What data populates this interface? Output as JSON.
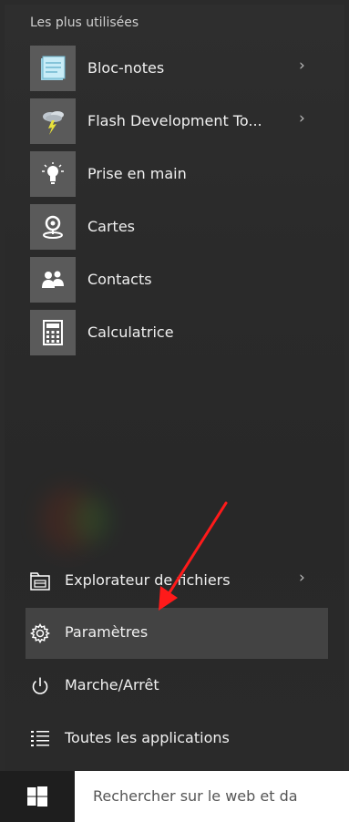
{
  "start_menu": {
    "section_header": "Les plus utilisées",
    "apps": [
      {
        "label": "Bloc-notes",
        "icon": "notepad-icon",
        "has_submenu": true
      },
      {
        "label": "Flash Development To...",
        "icon": "flash-development-icon",
        "has_submenu": true
      },
      {
        "label": "Prise en main",
        "icon": "lightbulb-icon",
        "has_submenu": false
      },
      {
        "label": "Cartes",
        "icon": "maps-icon",
        "has_submenu": false
      },
      {
        "label": "Contacts",
        "icon": "contacts-icon",
        "has_submenu": false
      },
      {
        "label": "Calculatrice",
        "icon": "calculator-icon",
        "has_submenu": false
      }
    ],
    "bottom_items": [
      {
        "label": "Explorateur de fichiers",
        "icon": "file-explorer-icon",
        "has_submenu": true
      },
      {
        "label": "Paramètres",
        "icon": "settings-gear-icon",
        "highlighted": true
      },
      {
        "label": "Marche/Arrêt",
        "icon": "power-icon"
      },
      {
        "label": "Toutes les applications",
        "icon": "all-apps-list-icon"
      }
    ],
    "chevron": "›"
  },
  "taskbar": {
    "start_icon": "windows-logo-icon",
    "search_placeholder": "Rechercher sur le web et da"
  },
  "colors": {
    "menu_bg": "#2b2b2b",
    "tile_bg": "#5a5a5a",
    "hover_bg": "#434343",
    "taskbar_bg": "#1e1e1e",
    "annotation_arrow": "#ff1a1a"
  }
}
